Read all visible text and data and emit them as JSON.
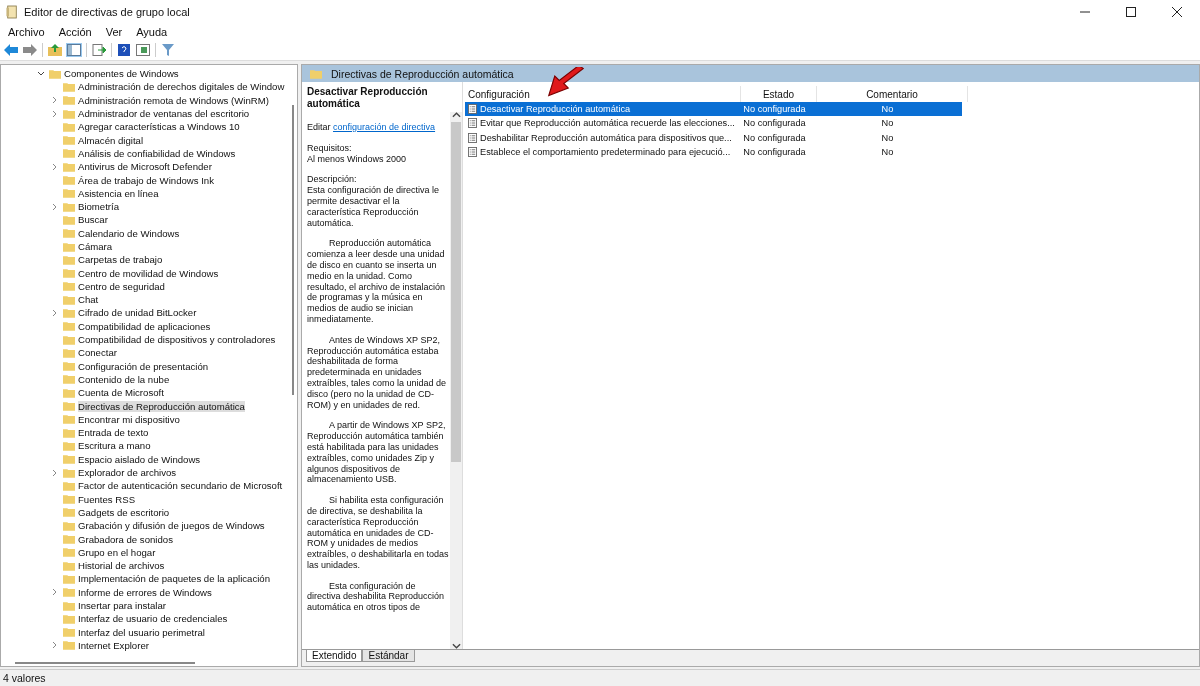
{
  "window": {
    "title": "Editor de directivas de grupo local"
  },
  "menu": [
    "Archivo",
    "Acción",
    "Ver",
    "Ayuda"
  ],
  "tree": [
    {
      "label": "Componentes de Windows",
      "expanded": true,
      "selected": false,
      "children": [
        {
          "label": "Administración de derechos digitales de Window",
          "expandable": false,
          "selected": false
        },
        {
          "label": "Administración remota de Windows (WinRM)",
          "expandable": true,
          "selected": false
        },
        {
          "label": "Administrador de ventanas del escritorio",
          "expandable": true,
          "selected": false
        },
        {
          "label": "Agregar características a Windows 10",
          "expandable": false,
          "selected": false
        },
        {
          "label": "Almacén digital",
          "expandable": false,
          "selected": false
        },
        {
          "label": "Análisis de confiabilidad de Windows",
          "expandable": false,
          "selected": false
        },
        {
          "label": "Antivirus de Microsoft Defender",
          "expandable": true,
          "selected": false
        },
        {
          "label": "Área de trabajo de Windows Ink",
          "expandable": false,
          "selected": false
        },
        {
          "label": "Asistencia en línea",
          "expandable": false,
          "selected": false
        },
        {
          "label": "Biometría",
          "expandable": true,
          "selected": false
        },
        {
          "label": "Buscar",
          "expandable": false,
          "selected": false
        },
        {
          "label": "Calendario de Windows",
          "expandable": false,
          "selected": false
        },
        {
          "label": "Cámara",
          "expandable": false,
          "selected": false
        },
        {
          "label": "Carpetas de trabajo",
          "expandable": false,
          "selected": false
        },
        {
          "label": "Centro de movilidad de Windows",
          "expandable": false,
          "selected": false
        },
        {
          "label": "Centro de seguridad",
          "expandable": false,
          "selected": false
        },
        {
          "label": "Chat",
          "expandable": false,
          "selected": false
        },
        {
          "label": "Cifrado de unidad BitLocker",
          "expandable": true,
          "selected": false
        },
        {
          "label": "Compatibilidad de aplicaciones",
          "expandable": false,
          "selected": false
        },
        {
          "label": "Compatibilidad de dispositivos y controladores",
          "expandable": false,
          "selected": false
        },
        {
          "label": "Conectar",
          "expandable": false,
          "selected": false
        },
        {
          "label": "Configuración de presentación",
          "expandable": false,
          "selected": false
        },
        {
          "label": "Contenido de la nube",
          "expandable": false,
          "selected": false
        },
        {
          "label": "Cuenta de Microsoft",
          "expandable": false,
          "selected": false
        },
        {
          "label": "Directivas de Reproducción automática",
          "expandable": false,
          "selected": true
        },
        {
          "label": "Encontrar mi dispositivo",
          "expandable": false,
          "selected": false
        },
        {
          "label": "Entrada de texto",
          "expandable": false,
          "selected": false
        },
        {
          "label": "Escritura a mano",
          "expandable": false,
          "selected": false
        },
        {
          "label": "Espacio aislado de Windows",
          "expandable": false,
          "selected": false
        },
        {
          "label": "Explorador de archivos",
          "expandable": true,
          "selected": false
        },
        {
          "label": "Factor de autenticación secundario de Microsoft",
          "expandable": false,
          "selected": false
        },
        {
          "label": "Fuentes RSS",
          "expandable": false,
          "selected": false
        },
        {
          "label": "Gadgets de escritorio",
          "expandable": false,
          "selected": false
        },
        {
          "label": "Grabación y difusión de juegos de Windows",
          "expandable": false,
          "selected": false
        },
        {
          "label": "Grabadora de sonidos",
          "expandable": false,
          "selected": false
        },
        {
          "label": "Grupo en el hogar",
          "expandable": false,
          "selected": false
        },
        {
          "label": "Historial de archivos",
          "expandable": false,
          "selected": false
        },
        {
          "label": "Implementación de paquetes de la aplicación",
          "expandable": false,
          "selected": false
        },
        {
          "label": "Informe de errores de Windows",
          "expandable": true,
          "selected": false
        },
        {
          "label": "Insertar para instalar",
          "expandable": false,
          "selected": false
        },
        {
          "label": "Interfaz de usuario de credenciales",
          "expandable": false,
          "selected": false
        },
        {
          "label": "Interfaz del usuario perimetral",
          "expandable": false,
          "selected": false
        },
        {
          "label": "Internet Explorer",
          "expandable": true,
          "selected": false
        }
      ]
    }
  ],
  "header": "Directivas de Reproducción automática",
  "details": {
    "title": "Desactivar Reproducción automática",
    "edit_prefix": "Editar",
    "edit_link": "configuración de directiva",
    "requirements_label": "Requisitos:",
    "requirements": "Al menos Windows 2000",
    "description_label": "Descripción:",
    "paragraphs": [
      "Esta configuración de directiva le permite desactivar el la característica Reproducción automática.",
      "Reproducción automática comienza a leer desde una unidad de disco en cuanto se inserta un medio en la unidad. Como resultado, el archivo de instalación de programas y la música en medios de audio se inician inmediatamente.",
      "Antes de Windows XP SP2, Reproducción automática estaba deshabilitada de forma predeterminada en unidades extraíbles, tales como la unidad de disco (pero no la unidad de CD-ROM) y en unidades de red.",
      "A partir de Windows XP SP2, Reproducción automática también está habilitada para las unidades extraíbles, como unidades Zip y algunos dispositivos de almacenamiento USB.",
      "Si habilita esta configuración de directiva, se deshabilita la característica Reproducción automática en unidades de CD-ROM y unidades de medios extraíbles, o deshabilitarla en todas las unidades.",
      "Esta configuración de directiva deshabilita Reproducción automática en otros tipos de"
    ]
  },
  "table": {
    "columns": [
      "Configuración",
      "Estado",
      "Comentario"
    ],
    "rows": [
      {
        "name": "Desactivar Reproducción automática",
        "state": "No configurada",
        "comment": "No",
        "selected": true
      },
      {
        "name": "Evitar que Reproducción automática recuerde las elecciones...",
        "state": "No configurada",
        "comment": "No",
        "selected": false
      },
      {
        "name": "Deshabilitar Reproducción automática para dispositivos que...",
        "state": "No configurada",
        "comment": "No",
        "selected": false
      },
      {
        "name": "Establece el comportamiento predeterminado para ejecució...",
        "state": "No configurada",
        "comment": "No",
        "selected": false
      }
    ]
  },
  "view_tabs": [
    {
      "label": "Extendido",
      "selected": true
    },
    {
      "label": "Estándar",
      "selected": false
    }
  ],
  "status_bar": "4 valores"
}
